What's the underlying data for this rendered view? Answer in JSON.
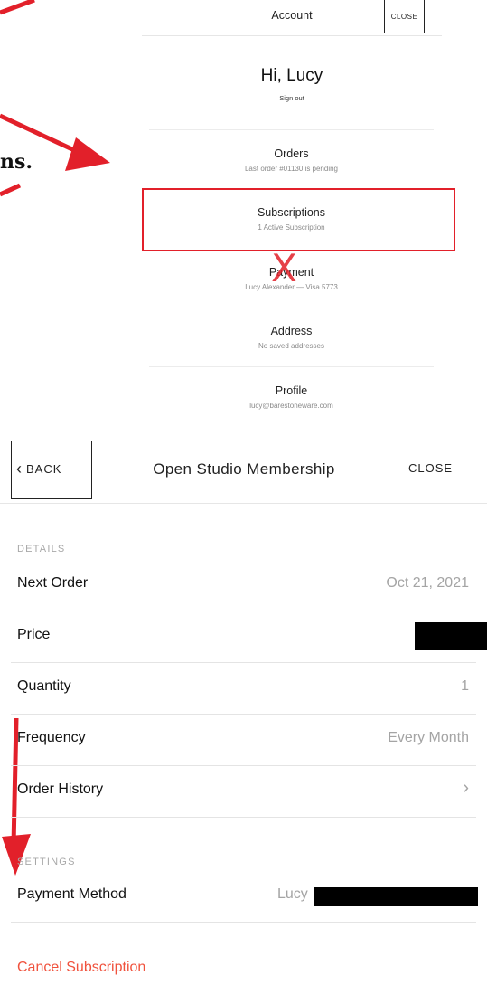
{
  "account_panel": {
    "title": "Account",
    "close_label": "CLOSE",
    "greeting": "Hi, Lucy",
    "sign_out": "Sign out",
    "items": [
      {
        "title": "Orders",
        "subtitle": "Last order #01130 is pending"
      },
      {
        "title": "Subscriptions",
        "subtitle": "1 Active Subscription"
      },
      {
        "title": "Payment",
        "subtitle": "Lucy Alexander — Visa 5773"
      },
      {
        "title": "Address",
        "subtitle": "No saved addresses"
      },
      {
        "title": "Profile",
        "subtitle": "lucy@barestoneware.com"
      }
    ]
  },
  "annotation": {
    "text": "ns.",
    "x_mark": "X",
    "color": "#e2202a"
  },
  "subscription_panel": {
    "back_label": "BACK",
    "title": "Open Studio Membership",
    "close_label": "CLOSE",
    "details_label": "DETAILS",
    "rows": [
      {
        "label": "Next Order",
        "value": "Oct 21, 2021"
      },
      {
        "label": "Price",
        "value": ""
      },
      {
        "label": "Quantity",
        "value": "1"
      },
      {
        "label": "Frequency",
        "value": "Every Month"
      },
      {
        "label": "Order History",
        "value": "›"
      }
    ],
    "settings_label": "SETTINGS",
    "payment_method": {
      "label": "Payment Method",
      "value": "Lucy"
    },
    "cancel_label": "Cancel Subscription",
    "cancel_color": "#f0523d"
  }
}
